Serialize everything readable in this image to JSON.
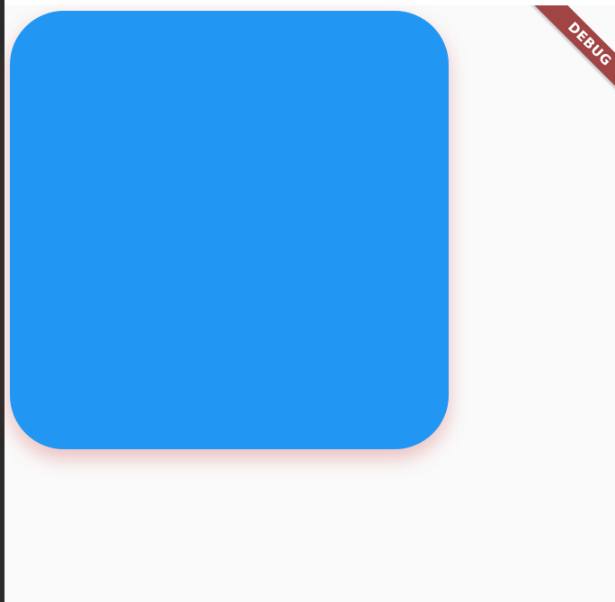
{
  "app": {
    "background_color": "#fafafa"
  },
  "card": {
    "color": "#2196f3",
    "shadow_color": "#e57373"
  },
  "debug_banner": {
    "label": "DEBUG",
    "color": "#a04444"
  }
}
